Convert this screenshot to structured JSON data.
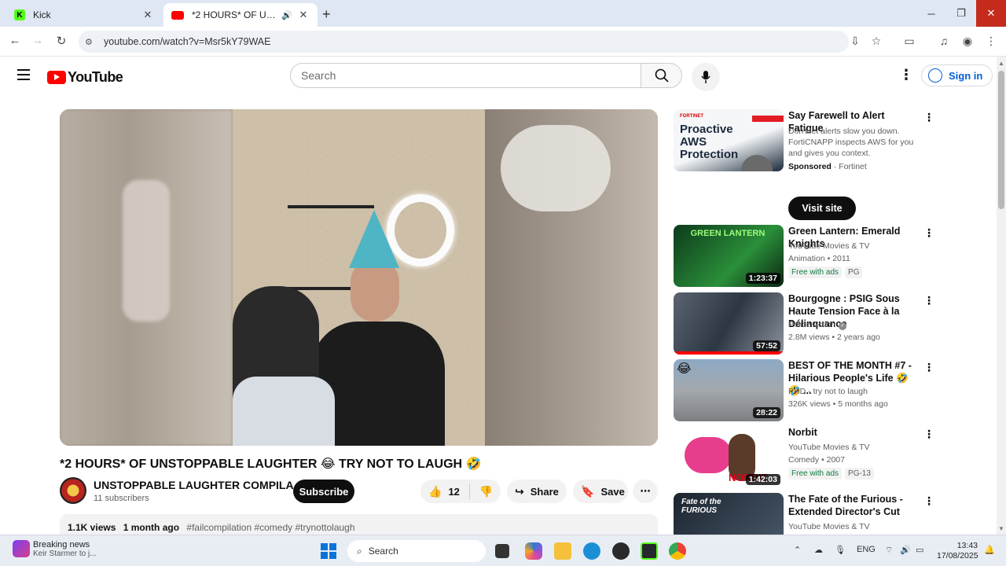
{
  "browser": {
    "tabs": [
      {
        "title": "Kick",
        "favicon": "kick-icon",
        "color": "#53fc18"
      },
      {
        "title": "*2 HOURS* OF UNSTOPPABLE LAUGHTER 🤣 TRY NOT TO LAUGH",
        "favicon": "youtube-icon",
        "color": "#ff0000"
      }
    ],
    "url": "youtube.com/watch?v=Msr5kY79WAE"
  },
  "header": {
    "logo_text": "YouTube",
    "search_placeholder": "Search",
    "signin_label": "Sign in"
  },
  "video": {
    "title": "*2 HOURS* OF UNSTOPPABLE LAUGHTER 😂 TRY NOT TO LAUGH 🤣",
    "channel_name": "UNSTOPPABLE LAUGHTER COMPILA...",
    "subscribers": "11 subscribers",
    "subscribe_label": "Subscribe",
    "likes": "12",
    "share_label": "Share",
    "save_label": "Save",
    "views": "1.1K views",
    "age": "1 month ago",
    "tags": "#failcompilation #comedy #trynottolaugh"
  },
  "sidebar": {
    "ad": {
      "title": "Say Farewell to Alert Fatigue",
      "description": "Don't let alerts slow you down. FortiCNAPP inspects AWS for you and gives you context.",
      "sponsored": "Sponsored",
      "advertiser": "Fortinet",
      "cta": "Visit site",
      "thumb_brand": "FORTINET",
      "thumb_text": "Proactive AWS Protection"
    },
    "items": [
      {
        "title": "Green Lantern: Emerald Knights",
        "channel": "YouTube Movies & TV",
        "meta": "Animation • 2011",
        "badge": "Free with ads",
        "rating": "PG",
        "duration": "1:23:37",
        "thumb_text": "GREEN LANTERN"
      },
      {
        "title": "Bourgogne : PSIG Sous Haute Tension Face à la Délinquance",
        "channel": "Police Action",
        "meta": "2.8M views • 2 years ago",
        "duration": "57:52"
      },
      {
        "title": "BEST OF THE MONTH #7 - Hilarious People's Life 🤣 🤣 ...",
        "channel": "PHD - try not to laugh",
        "meta": "326K views • 5 months ago",
        "duration": "28:22"
      },
      {
        "title": "Norbit",
        "channel": "YouTube Movies & TV",
        "meta": "Comedy • 2007",
        "badge": "Free with ads",
        "rating": "PG-13",
        "duration": "1:42:03",
        "thumb_text": "NORBIT"
      },
      {
        "title": "The Fate of the Furious - Extended Director's Cut",
        "channel": "YouTube Movies & TV",
        "thumb_text": "Fate of the FURIOUS"
      }
    ]
  },
  "taskbar": {
    "news_title": "Breaking news",
    "news_sub": "Keir Starmer to j...",
    "search_label": "Search",
    "lang": "ENG",
    "time": "13:43",
    "date": "17/08/2025"
  }
}
